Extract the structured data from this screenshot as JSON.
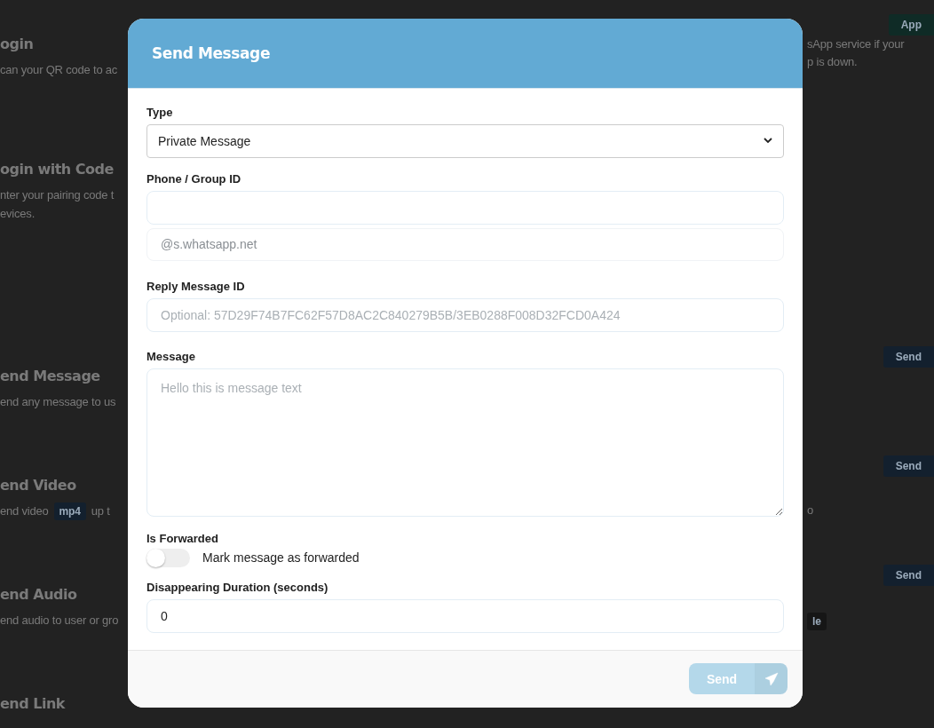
{
  "background": {
    "rows": [
      {
        "title": "ogin",
        "lines": [
          [
            {
              "kind": "text",
              "text": "can your QR code to ac"
            }
          ]
        ],
        "badge": {
          "text": "App",
          "color": "#0f2b26"
        },
        "right_lines": [
          [
            {
              "kind": "text",
              "text": "sApp service if your"
            }
          ],
          [
            {
              "kind": "text",
              "text": "p is down."
            }
          ]
        ]
      },
      {
        "title": "ogin with Code",
        "lines": [
          [
            {
              "kind": "text",
              "text": "nter your pairing code t"
            }
          ],
          [
            {
              "kind": "text",
              "text": "evices."
            }
          ]
        ]
      },
      {
        "title": "end Message",
        "lines": [
          [
            {
              "kind": "text",
              "text": "end any message to us"
            }
          ]
        ],
        "badge": {
          "text": "Send",
          "color": "#13202e"
        }
      },
      {
        "title": "end Video",
        "lines": [
          [
            {
              "kind": "text",
              "text": "end video"
            },
            {
              "kind": "badge",
              "text": "mp4",
              "color": "#13202e"
            },
            {
              "kind": "text",
              "text": "up t"
            }
          ]
        ],
        "badge": {
          "text": "Send",
          "color": "#13202e"
        },
        "right_lines": [
          [
            {
              "kind": "text",
              "text": "o"
            }
          ]
        ]
      },
      {
        "title": "end Audio",
        "lines": [
          [
            {
              "kind": "text",
              "text": "end audio to user or gro"
            }
          ]
        ],
        "badge": {
          "text": "Send",
          "color": "#13202e"
        },
        "right_lines": [
          [
            {
              "kind": "badge",
              "text": "le",
              "color": "#161616"
            }
          ]
        ]
      },
      {
        "title": "end Link"
      }
    ]
  },
  "modal": {
    "title": "Send Message",
    "type": {
      "label": "Type",
      "value": "Private Message"
    },
    "phone": {
      "label": "Phone / Group ID",
      "suffix": "@s.whatsapp.net"
    },
    "reply": {
      "label": "Reply Message ID",
      "placeholder": "Optional: 57D29F74B7FC62F57D8AC2C840279B5B/3EB0288F008D32FCD0A424"
    },
    "message": {
      "label": "Message",
      "placeholder": "Hello this is message text"
    },
    "forwarded": {
      "label": "Is Forwarded",
      "text": "Mark message as forwarded",
      "on": false
    },
    "duration": {
      "label": "Disappearing Duration (seconds)",
      "value": "0"
    },
    "send": {
      "label": "Send",
      "disabled": true
    }
  }
}
